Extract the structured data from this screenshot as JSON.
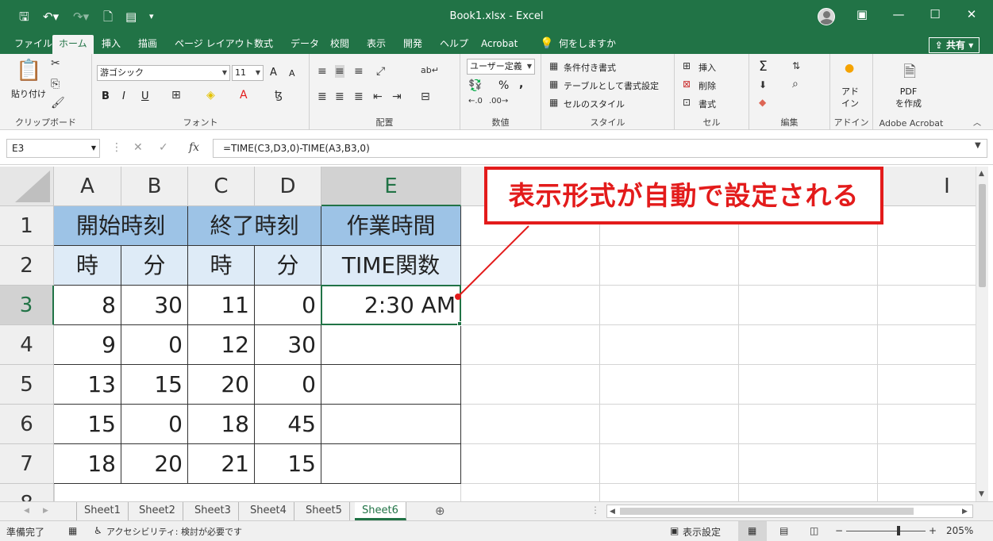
{
  "window": {
    "title": "Book1.xlsx  -  Excel",
    "quick_access": [
      "save-icon",
      "undo-icon",
      "redo-icon",
      "preview-icon",
      "form-icon",
      "customize-icon"
    ],
    "controls": [
      "ribbon-display-icon",
      "minimize-icon",
      "maximize-icon",
      "close-icon"
    ]
  },
  "ribbon_tabs": [
    "ファイル",
    "ホーム",
    "挿入",
    "描画",
    "ページ レイアウト",
    "数式",
    "データ",
    "校閲",
    "表示",
    "開発",
    "ヘルプ",
    "Acrobat"
  ],
  "active_tab": "ホーム",
  "tell_me": "何をしますか",
  "share_label": "共有",
  "groups": {
    "clipboard": {
      "label": "クリップボード",
      "paste": "貼り付け"
    },
    "font": {
      "label": "フォント",
      "font_name": "游ゴシック",
      "font_size": "11",
      "bold": "B",
      "italic": "I",
      "underline": "U",
      "grow": "A",
      "shrink": "A"
    },
    "alignment": {
      "label": "配置"
    },
    "number": {
      "label": "数値",
      "format": "ユーザー定義",
      "percent": "%",
      "comma": ","
    },
    "styles": {
      "label": "スタイル",
      "conditional": "条件付き書式",
      "table": "テーブルとして書式設定",
      "cell_styles": "セルのスタイル"
    },
    "cells": {
      "label": "セル",
      "insert": "挿入",
      "delete": "削除",
      "format": "書式"
    },
    "editing": {
      "label": "編集",
      "sum": "Σ"
    },
    "addins": {
      "label": "アドイン",
      "button": "アド\nイン"
    },
    "acrobat": {
      "label": "Adobe Acrobat",
      "button": "PDF\nを作成"
    }
  },
  "formula_bar": {
    "name_box": "E3",
    "fx": "fx",
    "formula": "=TIME(C3,D3,0)-TIME(A3,B3,0)"
  },
  "columns": [
    "A",
    "B",
    "C",
    "D",
    "E",
    "",
    "",
    "",
    "I"
  ],
  "selected_column": "E",
  "rows": [
    "1",
    "2",
    "3",
    "4",
    "5",
    "6",
    "7",
    "8"
  ],
  "selected_row": "3",
  "table": {
    "header1": [
      "開始時刻",
      "終了時刻",
      "作業時間"
    ],
    "header2": [
      "時",
      "分",
      "時",
      "分",
      "TIME関数"
    ],
    "data": [
      [
        "8",
        "30",
        "11",
        "0",
        "2:30 AM"
      ],
      [
        "9",
        "0",
        "12",
        "30",
        ""
      ],
      [
        "13",
        "15",
        "20",
        "0",
        ""
      ],
      [
        "15",
        "0",
        "18",
        "45",
        ""
      ],
      [
        "18",
        "20",
        "21",
        "15",
        ""
      ]
    ]
  },
  "callout": {
    "text": "表示形式が自動で設定される",
    "color": "#e31b1b"
  },
  "sheets": [
    "Sheet1",
    "Sheet2",
    "Sheet3",
    "Sheet4",
    "Sheet5",
    "Sheet6"
  ],
  "active_sheet": "Sheet6",
  "status": {
    "ready": "準備完了",
    "accessibility": "アクセシビリティ: 検討が必要です",
    "display_settings": "表示設定",
    "zoom": "205%"
  },
  "colors": {
    "excel_green": "#217346",
    "header_blue": "#9dc3e6",
    "subheader_blue": "#deebf7"
  }
}
